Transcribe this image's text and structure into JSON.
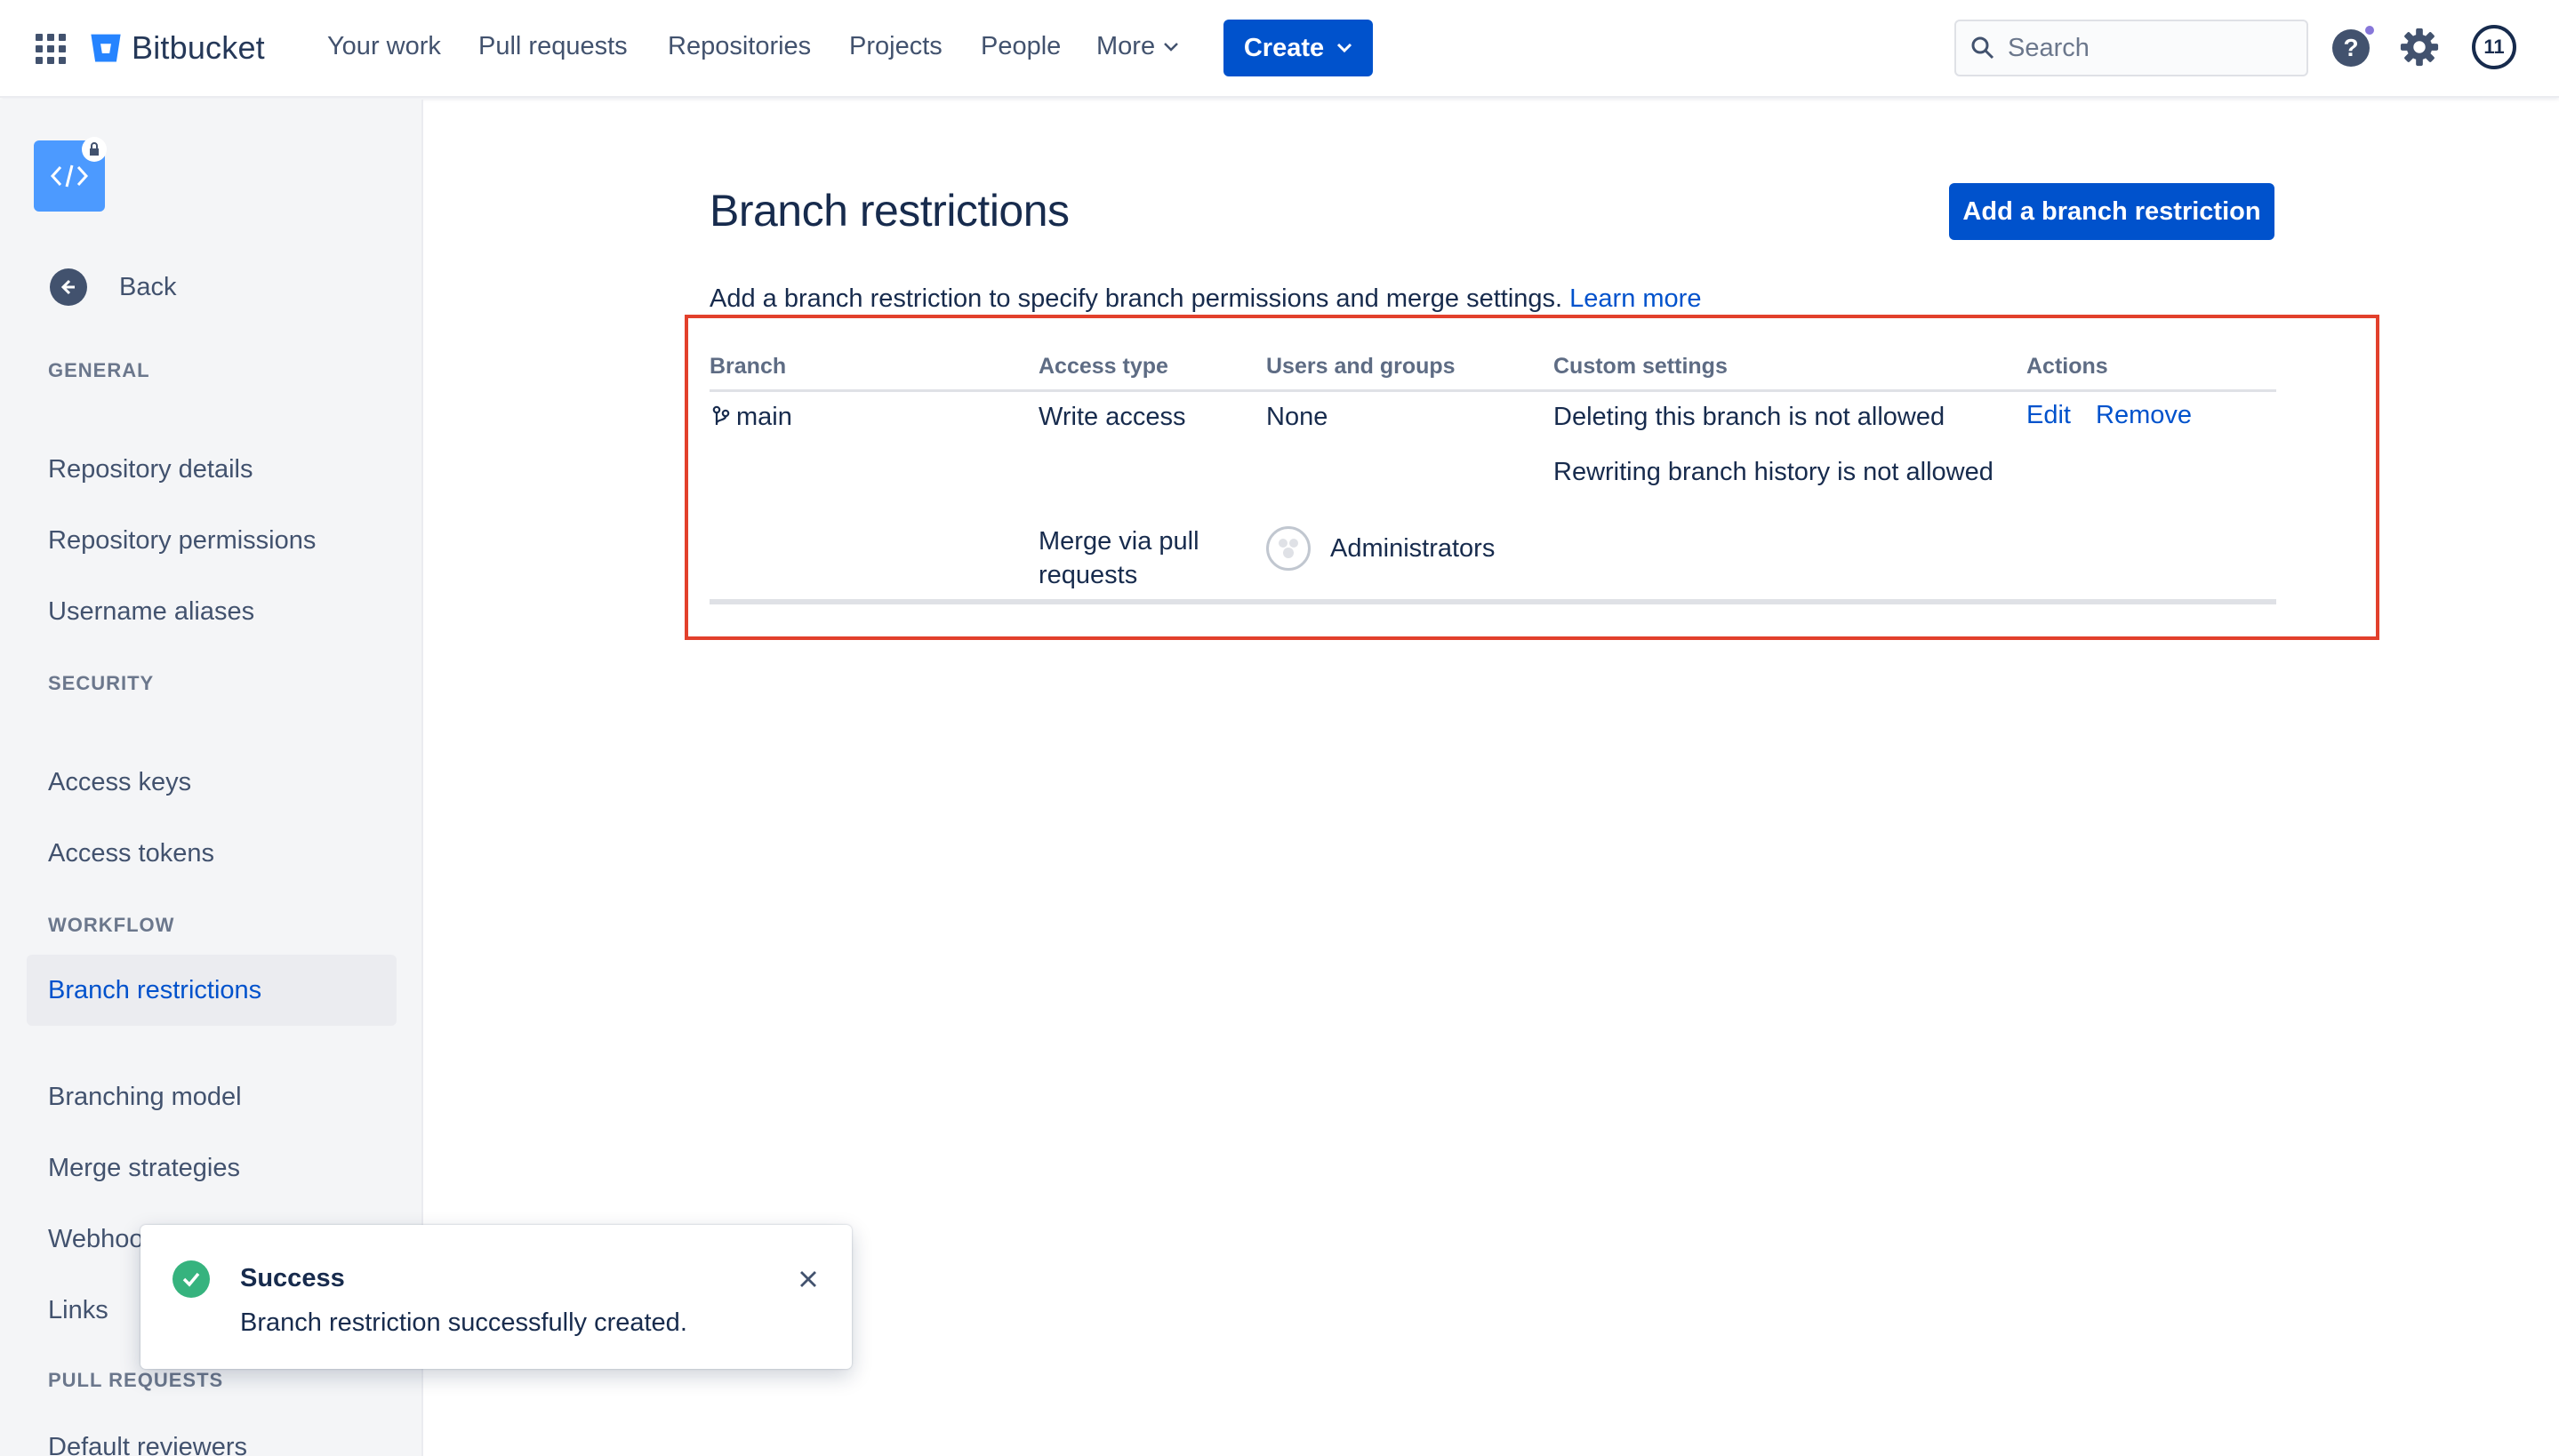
{
  "topbar": {
    "brand": "Bitbucket",
    "nav": [
      "Your work",
      "Pull requests",
      "Repositories",
      "Projects",
      "People"
    ],
    "more_label": "More",
    "create_label": "Create",
    "search_placeholder": "Search",
    "avatar_initials": "11"
  },
  "sidebar": {
    "back_label": "Back",
    "sections": [
      {
        "heading": "GENERAL",
        "items": [
          "Repository details",
          "Repository permissions",
          "Username aliases"
        ]
      },
      {
        "heading": "SECURITY",
        "items": [
          "Access keys",
          "Access tokens"
        ]
      },
      {
        "heading": "WORKFLOW",
        "items": [
          "Branch restrictions",
          "Branching model",
          "Merge strategies",
          "Webhooks",
          "Links"
        ]
      },
      {
        "heading": "PULL REQUESTS",
        "items": [
          "Default reviewers"
        ]
      }
    ],
    "active_item": "Branch restrictions"
  },
  "main": {
    "title": "Branch restrictions",
    "add_button": "Add a branch restriction",
    "description": "Add a branch restriction to specify branch permissions and merge settings.",
    "learn_more": "Learn more",
    "table": {
      "headers": [
        "Branch",
        "Access type",
        "Users and groups",
        "Custom settings",
        "Actions"
      ],
      "row": {
        "branch": "main",
        "access_1": "Write access",
        "users_1": "None",
        "custom_1": "Deleting this branch is not allowed",
        "custom_2": "Rewriting branch history is not allowed",
        "access_2_line1": "Merge via pull",
        "access_2_line2": "requests",
        "users_2": "Administrators",
        "edit": "Edit",
        "remove": "Remove"
      }
    }
  },
  "flag": {
    "title": "Success",
    "body": "Branch restriction successfully created."
  },
  "colors": {
    "primary": "#0052cc",
    "success": "#36b37e",
    "highlight": "#e2402c",
    "sidebar_bg": "#f4f5f7"
  }
}
